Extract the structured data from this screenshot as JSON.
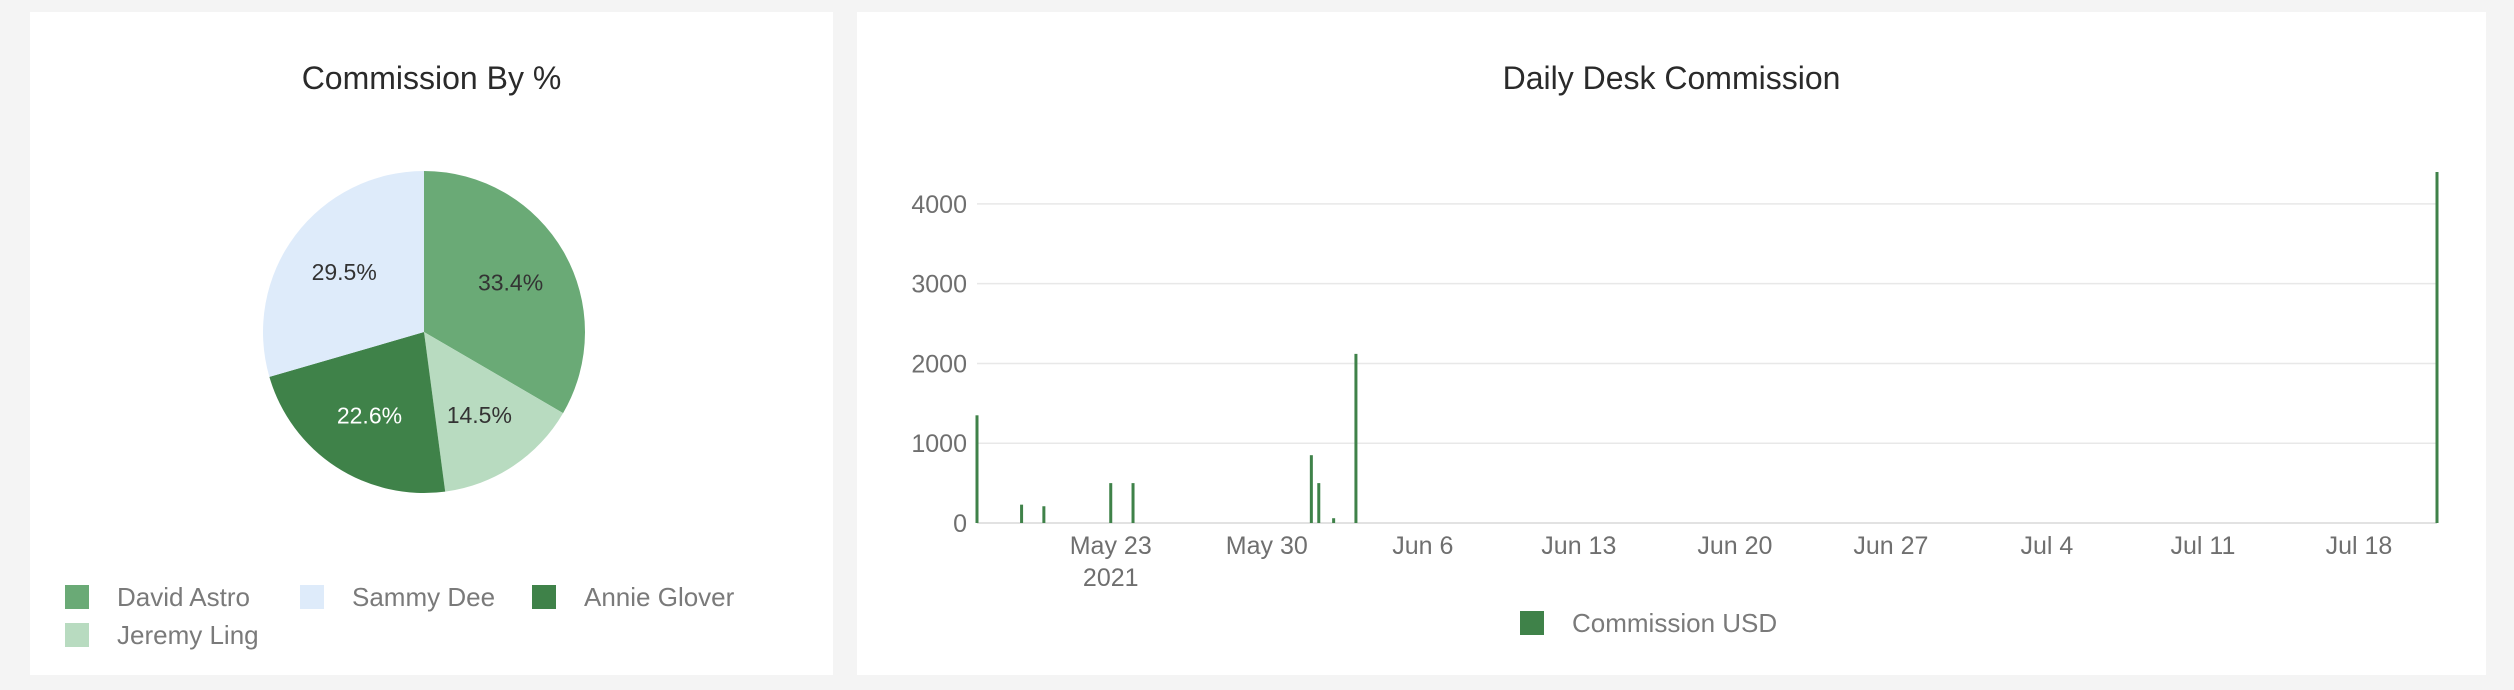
{
  "pie_card": {
    "title": "Commission By %"
  },
  "bar_card": {
    "title": "Daily Desk Commission"
  },
  "chart_data": [
    {
      "type": "pie",
      "title": "Commission By %",
      "slices": [
        {
          "name": "David Astro",
          "value": 33.4,
          "label": "33.4%",
          "color": "#6aaa76",
          "label_color": "#333333"
        },
        {
          "name": "Jeremy Ling",
          "value": 14.5,
          "label": "14.5%",
          "color": "#b8dbc0",
          "label_color": "#333333"
        },
        {
          "name": "Annie Glover",
          "value": 22.6,
          "label": "22.6%",
          "color": "#3f8249",
          "label_color": "#ffffff"
        },
        {
          "name": "Sammy Dee",
          "value": 29.5,
          "label": "29.5%",
          "color": "#deebfa",
          "label_color": "#333333"
        }
      ],
      "legend": {
        "placement": "bottom",
        "order": [
          "David Astro",
          "Sammy Dee",
          "Annie Glover",
          "Jeremy Ling"
        ]
      }
    },
    {
      "type": "bar",
      "title": "Daily Desk Commission",
      "series": [
        {
          "name": "Commission USD",
          "color": "#3f8249",
          "points": [
            {
              "x": "2021-05-17",
              "y": 1350
            },
            {
              "x": "2021-05-19",
              "y": 230
            },
            {
              "x": "2021-05-20",
              "y": 210
            },
            {
              "x": "2021-05-23",
              "y": 500
            },
            {
              "x": "2021-05-24",
              "y": 500
            },
            {
              "x": "2021-06-01",
              "y": 850
            },
            {
              "x": "2021-06-01T08:00",
              "y": 500
            },
            {
              "x": "2021-06-02",
              "y": 60
            },
            {
              "x": "2021-06-03",
              "y": 2120
            },
            {
              "x": "2021-07-21T12:00",
              "y": 4400
            }
          ]
        }
      ],
      "x_axis": {
        "type": "time",
        "min": "2021-05-17",
        "max": "2021-07-21T12:00",
        "ticks": [
          {
            "date": "2021-05-23",
            "label": "May 23",
            "sublabel": "2021"
          },
          {
            "date": "2021-05-30",
            "label": "May 30"
          },
          {
            "date": "2021-06-06",
            "label": "Jun 6"
          },
          {
            "date": "2021-06-13",
            "label": "Jun 13"
          },
          {
            "date": "2021-06-20",
            "label": "Jun 20"
          },
          {
            "date": "2021-06-27",
            "label": "Jun 27"
          },
          {
            "date": "2021-07-04",
            "label": "Jul 4"
          },
          {
            "date": "2021-07-11",
            "label": "Jul 11"
          },
          {
            "date": "2021-07-18",
            "label": "Jul 18"
          }
        ]
      },
      "y_axis": {
        "min": 0,
        "max": 4400,
        "ticks": [
          {
            "value": 0,
            "label": "0"
          },
          {
            "value": 1000,
            "label": "1000"
          },
          {
            "value": 2000,
            "label": "2000"
          },
          {
            "value": 3000,
            "label": "3000"
          },
          {
            "value": 4000,
            "label": "4000"
          }
        ]
      },
      "grid": true,
      "legend": {
        "placement": "bottom"
      }
    }
  ]
}
